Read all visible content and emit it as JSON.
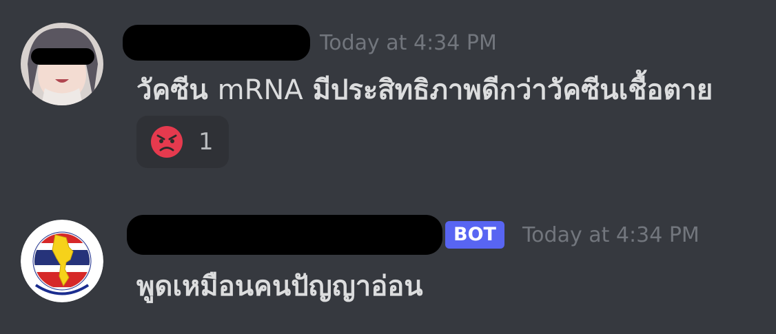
{
  "messages": [
    {
      "author_name": "",
      "timestamp": "Today at 4:34 PM",
      "content_prefix": "วัคซีน",
      "content_latin": "mRNA",
      "content_suffix": "มีประสิทธิภาพดีกว่าวัคซีนเชื้อตาย",
      "reaction": {
        "emoji": "angry-face-icon",
        "count": "1"
      }
    },
    {
      "author_name": "",
      "bot_tag": "BOT",
      "timestamp": "Today at 4:34 PM",
      "content": "พูดเหมือนคนปัญญาอ่อน"
    }
  ],
  "colors": {
    "background": "#36393f",
    "reaction_bg": "#2f3136",
    "bot_tag": "#5865f2",
    "angry_emoji": "#e53a4e",
    "timestamp": "#72767d"
  }
}
